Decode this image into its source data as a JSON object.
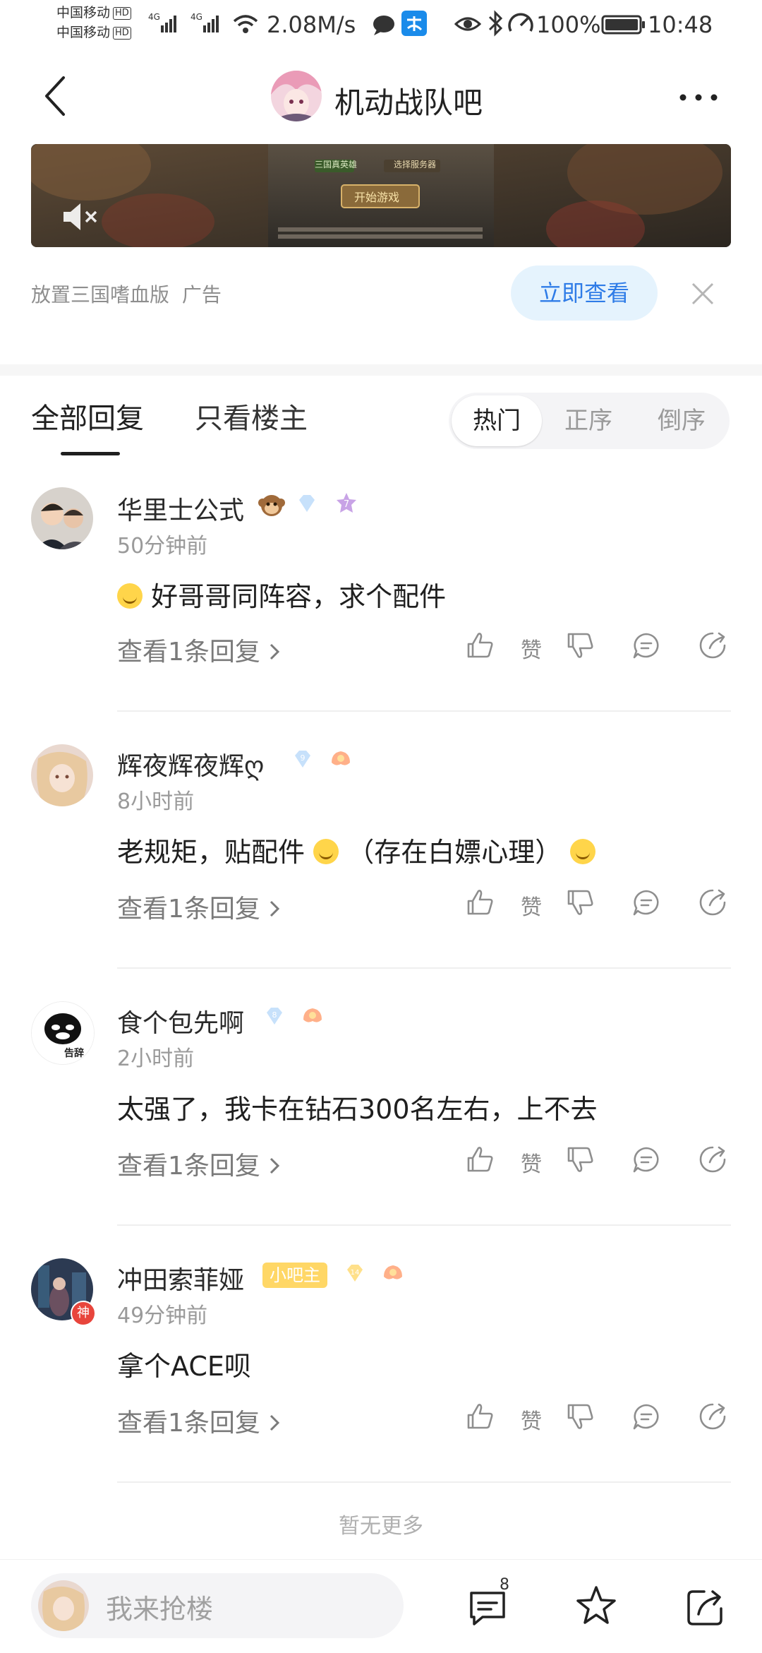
{
  "status_bar": {
    "carrier1": "中国移动",
    "carrier2": "中国移动",
    "hd": "HD",
    "net_speed": "2.08M/s",
    "battery": "100%",
    "time": "10:48"
  },
  "header": {
    "title": "机动战队吧"
  },
  "ad": {
    "source": "放置三国嗜血版",
    "ad_label": "广告",
    "cta": "立即查看",
    "banner_button": "开始游戏",
    "banner_server": "三国真英雄",
    "banner_select": "选择服务器"
  },
  "tabs": {
    "all_replies": "全部回复",
    "only_op": "只看楼主"
  },
  "sort": {
    "hot": "热门",
    "asc": "正序",
    "desc": "倒序"
  },
  "comments": [
    {
      "name": "华里士公式",
      "badge_level": "7",
      "time": "50分钟前",
      "text": "好哥哥同阵容，求个配件",
      "replies": "查看1条回复",
      "like_label": "赞"
    },
    {
      "name": "辉夜辉夜辉ღ",
      "badge_level": "9",
      "time": "8小时前",
      "text_a": "老规矩，贴配件",
      "text_b": "（存在白嫖心理）",
      "replies": "查看1条回复",
      "like_label": "赞"
    },
    {
      "name": "食个包先啊",
      "badge_level": "8",
      "time": "2小时前",
      "text": "太强了，我卡在钻石300名左右，上不去",
      "replies": "查看1条回复",
      "like_label": "赞",
      "avatar_caption": "告辞"
    },
    {
      "name": "冲田索菲娅",
      "owner_badge": "小吧主",
      "badge_level": "14",
      "time": "49分钟前",
      "text": "拿个ACE呗",
      "replies": "查看1条回复",
      "like_label": "赞",
      "avatar_tag": "神"
    }
  ],
  "footer": {
    "no_more": "暂无更多"
  },
  "bottom_bar": {
    "input_placeholder": "我来抢楼",
    "comment_count": "8"
  },
  "colors": {
    "accent_blue": "#2f7ce7",
    "cta_bg": "#e5f3fd",
    "owner_badge": "#ffd766"
  }
}
